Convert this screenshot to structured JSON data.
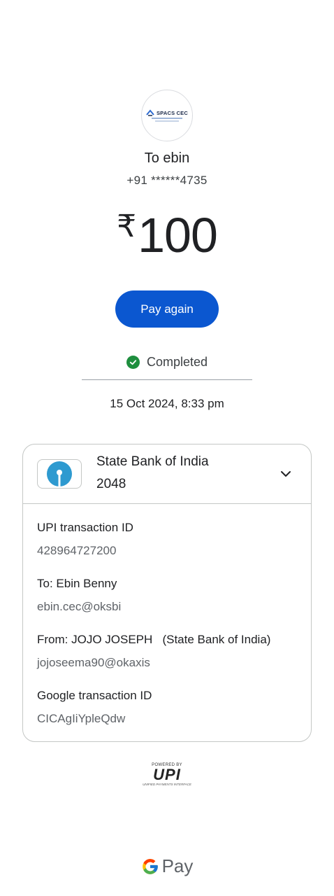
{
  "payee": {
    "logo_text": "SPACS CEC",
    "title": "To ebin",
    "phone": "+91 ******4735"
  },
  "amount": {
    "currency_symbol": "₹",
    "value": "100"
  },
  "actions": {
    "pay_again_label": "Pay again"
  },
  "status": {
    "label": "Completed",
    "color": "#1e8e3e",
    "datetime": "15 Oct 2024, 8:33 pm"
  },
  "bank": {
    "name": "State Bank of India",
    "account": "2048",
    "logo_color": "#2e9ad0"
  },
  "details": {
    "upi_txn_label": "UPI transaction ID",
    "upi_txn_value": "428964727200",
    "to_label": "To: Ebin  Benny",
    "to_value": "ebin.cec@oksbi",
    "from_label": "From: JOJO JOSEPH   (State Bank of India)",
    "from_value": "jojoseema90@okaxis",
    "google_txn_label": "Google transaction ID",
    "google_txn_value": "CICAgIiYpleQdw"
  },
  "footer": {
    "upi_powered": "POWERED BY",
    "upi_word": "UPI",
    "upi_tag": "UNIFIED PAYMENTS INTERFACE",
    "gpay_text": "Pay"
  },
  "colors": {
    "primary": "#0b57d0"
  }
}
